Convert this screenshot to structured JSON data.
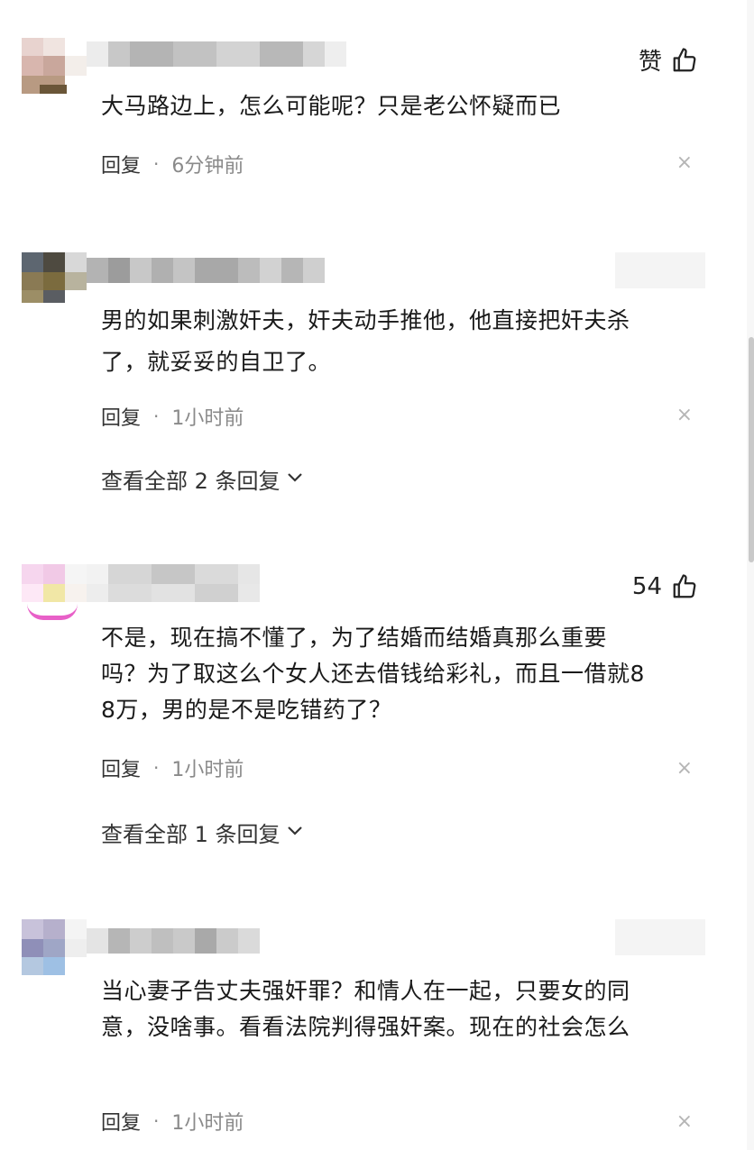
{
  "comments": [
    {
      "like_label": "赞",
      "text": "大马路边上，怎么可能呢？只是老公怀疑而已",
      "reply_label": "回复",
      "separator": "·",
      "time": "6分钟前",
      "close_glyph": "×"
    },
    {
      "text_line1": "男的如果刺激奸夫，奸夫动手推他，他直接把奸夫杀",
      "text_line2": "了，就妥妥的自卫了。",
      "reply_label": "回复",
      "separator": "·",
      "time": "1小时前",
      "close_glyph": "×",
      "view_all": "查看全部 2 条回复",
      "chevron": "⌄"
    },
    {
      "like_count": "54",
      "text_line1": "不是，现在搞不懂了，为了结婚而结婚真那么重要",
      "text_line2": "吗？为了取这么个女人还去借钱给彩礼，而且一借就8",
      "text_line3": "8万，男的是不是吃错药了？",
      "reply_label": "回复",
      "separator": "·",
      "time": "1小时前",
      "close_glyph": "×",
      "view_all": "查看全部 1 条回复",
      "chevron": "⌄"
    },
    {
      "text_line1": "当心妻子告丈夫强奸罪？和情人在一起，只要女的同",
      "text_line2": "意，没啥事。看看法院判得强奸案。现在的社会怎么",
      "reply_label": "回复",
      "separator": "·",
      "time": "1小时前",
      "close_glyph": "×"
    }
  ],
  "icons": {
    "like": "thumbs-up-icon",
    "close": "close-icon",
    "expand": "chevron-down-icon"
  },
  "colors": {
    "text": "#1a1a1a",
    "meta_time": "#8a8a8a",
    "close": "#b5b5b5"
  }
}
